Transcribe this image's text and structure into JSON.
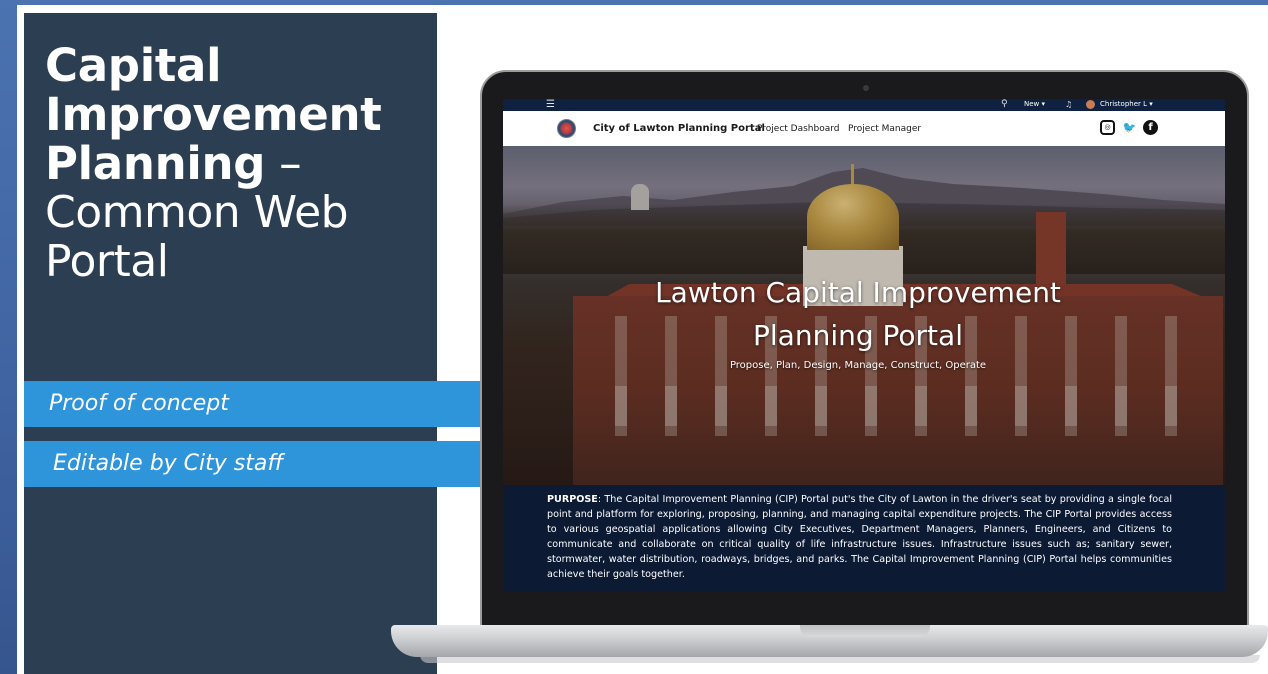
{
  "slide": {
    "title_line1": "Capital",
    "title_line2": "Improvement",
    "title_line3_bold": "Planning",
    "title_dash": " –",
    "title_line4": "Common Web",
    "title_line5": "Portal",
    "callouts": [
      {
        "label": "Proof of concept"
      },
      {
        "label": "Editable by City staff"
      }
    ],
    "callout_color": "#2f95db",
    "panel_color": "#2c3e52"
  },
  "portal": {
    "topbar": {
      "new_label": "New ▾",
      "user_name": "Christopher L ▾",
      "icons": [
        "menu-icon",
        "search-icon",
        "bell-icon",
        "avatar"
      ]
    },
    "nav": {
      "site_title": "City of Lawton Planning Portal",
      "links": [
        "Project Dashboard",
        "Project Manager"
      ],
      "social_icons": [
        "instagram-icon",
        "twitter-icon",
        "facebook-icon"
      ]
    },
    "hero": {
      "title_line1": "Lawton Capital Improvement",
      "title_line2": "Planning Portal",
      "subtitle": "Propose, Plan, Design, Manage, Construct, Operate"
    },
    "purpose": {
      "label": "PURPOSE",
      "text": ": The Capital Improvement Planning (CIP) Portal put's the City of Lawton in the driver's seat by providing a single focal point and platform for exploring, proposing, planning, and managing capital expenditure projects. The CIP Portal provides access to various geospatial applications allowing City Executives, Department Managers, Planners, Engineers, and Citizens to communicate and collaborate on critical quality of life infrastructure issues. Infrastructure issues such as; sanitary sewer, stormwater, water distribution, roadways, bridges, and parks. The Capital Improvement Planning (CIP) Portal helps communities achieve their goals together."
    }
  }
}
